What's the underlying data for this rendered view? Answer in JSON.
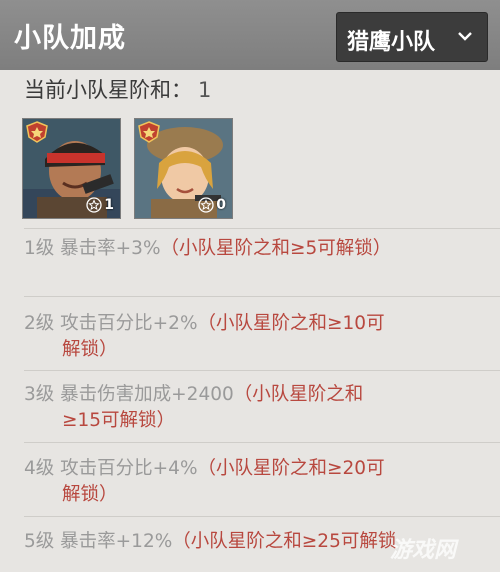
{
  "header": {
    "title": "小队加成",
    "squad_select": {
      "selected": "猎鹰小队"
    }
  },
  "star_sum": {
    "label": "当前小队星阶和：",
    "value": "1"
  },
  "members": [
    {
      "stars": "1"
    },
    {
      "stars": "0"
    }
  ],
  "bonuses": [
    {
      "level": "1级",
      "effect": "暴击率+3%",
      "condition": "（小队星阶之和≥5可解锁）"
    },
    {
      "level": "2级",
      "effect": "攻击百分比+2%",
      "condition_a": "（小队星阶之和≥10可",
      "condition_b": "解锁）"
    },
    {
      "level": "3级",
      "effect": "暴击伤害加成+2400",
      "condition_a": "（小队星阶之和",
      "condition_b": "≥15可解锁）"
    },
    {
      "level": "4级",
      "effect": "攻击百分比+4%",
      "condition_a": "（小队星阶之和≥20可",
      "condition_b": "解锁）"
    },
    {
      "level": "5级",
      "effect": "暴击率+12%",
      "condition": "（小队星阶之和≥25可解锁"
    }
  ],
  "watermark": "游戏网"
}
